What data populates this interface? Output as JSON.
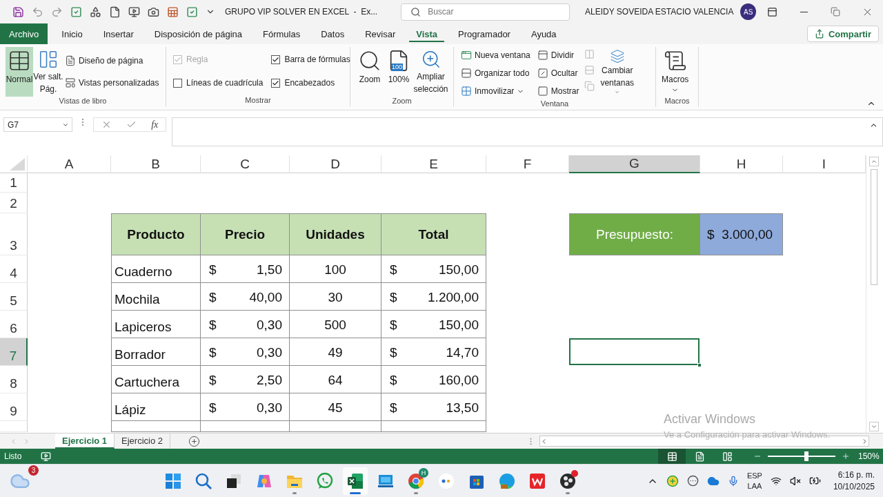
{
  "title_bar": {
    "document_title": "GRUPO VIP SOLVER EN EXCEL  -  Ex...",
    "search": {
      "placeholder": "Buscar"
    },
    "user_name": "ALEIDY SOVEIDA ESTACIO VALENCIA",
    "avatar_initials": "AS"
  },
  "menu_tabs": [
    {
      "label": "Archivo",
      "kind": "file",
      "selected": false
    },
    {
      "label": "Inicio",
      "kind": "tab",
      "selected": false
    },
    {
      "label": "Insertar",
      "kind": "tab",
      "selected": false
    },
    {
      "label": "Disposición de página",
      "kind": "tab",
      "selected": false
    },
    {
      "label": "Fórmulas",
      "kind": "tab",
      "selected": false
    },
    {
      "label": "Datos",
      "kind": "tab",
      "selected": false
    },
    {
      "label": "Revisar",
      "kind": "tab",
      "selected": false
    },
    {
      "label": "Vista",
      "kind": "tab",
      "selected": true
    },
    {
      "label": "Programador",
      "kind": "tab",
      "selected": false
    },
    {
      "label": "Ayuda",
      "kind": "tab",
      "selected": false
    }
  ],
  "share_button": "Compartir",
  "ribbon": {
    "groups": [
      {
        "kind": "views",
        "label": "Vistas de libro",
        "large": [
          {
            "kind": "normal",
            "lines": [
              "Normal"
            ],
            "selected": true
          },
          {
            "kind": "page_break",
            "lines": [
              "Ver salt.",
              "Pág."
            ],
            "selected": false
          }
        ],
        "small": [
          {
            "kind": "page_layout",
            "label": "Diseño de página"
          },
          {
            "kind": "custom_views",
            "label": "Vistas personalizadas"
          }
        ]
      },
      {
        "kind": "show",
        "label": "Mostrar",
        "checkboxes": [
          {
            "kind": "ruler",
            "label": "Regla",
            "checked": true,
            "disabled": true
          },
          {
            "kind": "gridlines",
            "label": "Líneas de cuadrícula",
            "checked": false,
            "disabled": false
          },
          {
            "kind": "formula_bar",
            "label": "Barra de fórmulas",
            "checked": true,
            "disabled": false
          },
          {
            "kind": "headings",
            "label": "Encabezados",
            "checked": true,
            "disabled": false
          }
        ]
      },
      {
        "kind": "zoom",
        "label": "Zoom",
        "buttons": [
          {
            "kind": "zoom",
            "lines": [
              "Zoom"
            ]
          },
          {
            "kind": "zoom100",
            "lines": [
              "100%"
            ],
            "icon_text": "100"
          },
          {
            "kind": "selection",
            "lines": [
              "Ampliar",
              "selección"
            ]
          }
        ]
      },
      {
        "kind": "window",
        "label": "Ventana",
        "items": [
          {
            "kind": "new",
            "label": "Nueva ventana",
            "menu": false
          },
          {
            "kind": "arrange",
            "label": "Organizar todo",
            "menu": false
          },
          {
            "kind": "freeze",
            "label": "Inmovilizar",
            "menu": true
          },
          {
            "kind": "split",
            "label": "Dividir",
            "menu": false
          },
          {
            "kind": "hide",
            "label": "Ocultar",
            "menu": false
          },
          {
            "kind": "unhide",
            "label": "Mostrar",
            "menu": false
          }
        ],
        "switch": {
          "lines": [
            "Cambiar",
            "ventanas"
          ]
        }
      },
      {
        "kind": "macros",
        "label": "Macros",
        "button": {
          "lines": [
            "Macros"
          ]
        }
      }
    ]
  },
  "formula_bar": {
    "name_box": "G7",
    "function_button": "fx"
  },
  "sheet": {
    "columns": [
      {
        "label": "A",
        "selected": false
      },
      {
        "label": "B",
        "selected": false
      },
      {
        "label": "C",
        "selected": false
      },
      {
        "label": "D",
        "selected": false
      },
      {
        "label": "E",
        "selected": false
      },
      {
        "label": "F",
        "selected": false
      },
      {
        "label": "G",
        "selected": true
      },
      {
        "label": "H",
        "selected": false
      },
      {
        "label": "I",
        "selected": false
      }
    ],
    "rows": [
      {
        "label": "1",
        "selected": false
      },
      {
        "label": "2",
        "selected": false
      },
      {
        "label": "3",
        "selected": false
      },
      {
        "label": "4",
        "selected": false
      },
      {
        "label": "5",
        "selected": false
      },
      {
        "label": "6",
        "selected": false
      },
      {
        "label": "7",
        "selected": true
      },
      {
        "label": "8",
        "selected": false
      },
      {
        "label": "9",
        "selected": false
      }
    ],
    "table": {
      "headers": [
        "Producto",
        "Precio",
        "Unidades",
        "Total"
      ],
      "rows": [
        {
          "product": "Cuaderno",
          "price": {
            "symbol": "$",
            "amount": "1,50"
          },
          "units": "100",
          "total": {
            "symbol": "$",
            "amount": "150,00"
          }
        },
        {
          "product": "Mochila",
          "price": {
            "symbol": "$",
            "amount": "40,00"
          },
          "units": "30",
          "total": {
            "symbol": "$",
            "amount": "1.200,00"
          }
        },
        {
          "product": "Lapiceros",
          "price": {
            "symbol": "$",
            "amount": "0,30"
          },
          "units": "500",
          "total": {
            "symbol": "$",
            "amount": "150,00"
          }
        },
        {
          "product": "Borrador",
          "price": {
            "symbol": "$",
            "amount": "0,30"
          },
          "units": "49",
          "total": {
            "symbol": "$",
            "amount": "14,70"
          }
        },
        {
          "product": "Cartuchera",
          "price": {
            "symbol": "$",
            "amount": "2,50"
          },
          "units": "64",
          "total": {
            "symbol": "$",
            "amount": "160,00"
          }
        },
        {
          "product": "Lápiz",
          "price": {
            "symbol": "$",
            "amount": "0,30"
          },
          "units": "45",
          "total": {
            "symbol": "$",
            "amount": "13,50"
          }
        }
      ]
    },
    "budget": {
      "label": "Presupuesto:",
      "symbol": "$",
      "amount": "3.000,00"
    }
  },
  "sheet_tabs": [
    {
      "label": "Ejercicio 1",
      "selected": true
    },
    {
      "label": "Ejercicio 2",
      "selected": false
    }
  ],
  "activation_notice": {
    "title": "Activar Windows",
    "message": "Ve a Configuración para activar Windows."
  },
  "status_bar": {
    "status": "Listo",
    "views": [
      {
        "kind": "normal",
        "selected": true
      },
      {
        "kind": "layout",
        "selected": false
      },
      {
        "kind": "break",
        "selected": false
      }
    ],
    "zoom": {
      "level": 0.57,
      "reading": "150%"
    }
  },
  "taskbar": {
    "weather_badge": "3",
    "apps": [
      {
        "kind": "start",
        "running": false,
        "selected": false,
        "alert": false
      },
      {
        "kind": "search",
        "running": false,
        "selected": false,
        "alert": false
      },
      {
        "kind": "task_view",
        "running": false,
        "selected": false,
        "alert": false
      },
      {
        "kind": "copilot",
        "running": false,
        "selected": false,
        "alert": false
      },
      {
        "kind": "files",
        "running": true,
        "selected": false,
        "alert": false
      },
      {
        "kind": "whatsapp",
        "running": false,
        "selected": false,
        "alert": false
      },
      {
        "kind": "excel",
        "running": true,
        "selected": true,
        "alert": false
      },
      {
        "kind": "screen",
        "running": false,
        "selected": false,
        "alert": false
      },
      {
        "kind": "chrome",
        "running": true,
        "selected": false,
        "alert": false,
        "badge": "H"
      },
      {
        "kind": "dots",
        "running": false,
        "selected": false,
        "alert": false
      },
      {
        "kind": "store",
        "running": false,
        "selected": false,
        "alert": false
      },
      {
        "kind": "edge",
        "running": false,
        "selected": false,
        "alert": false
      },
      {
        "kind": "wps",
        "running": false,
        "selected": false,
        "alert": false
      },
      {
        "kind": "obs",
        "running": true,
        "selected": false,
        "alert": true
      }
    ],
    "language": [
      "ESP",
      "LAA"
    ],
    "time": "6:16 p. m.",
    "date": "10/10/2025"
  }
}
